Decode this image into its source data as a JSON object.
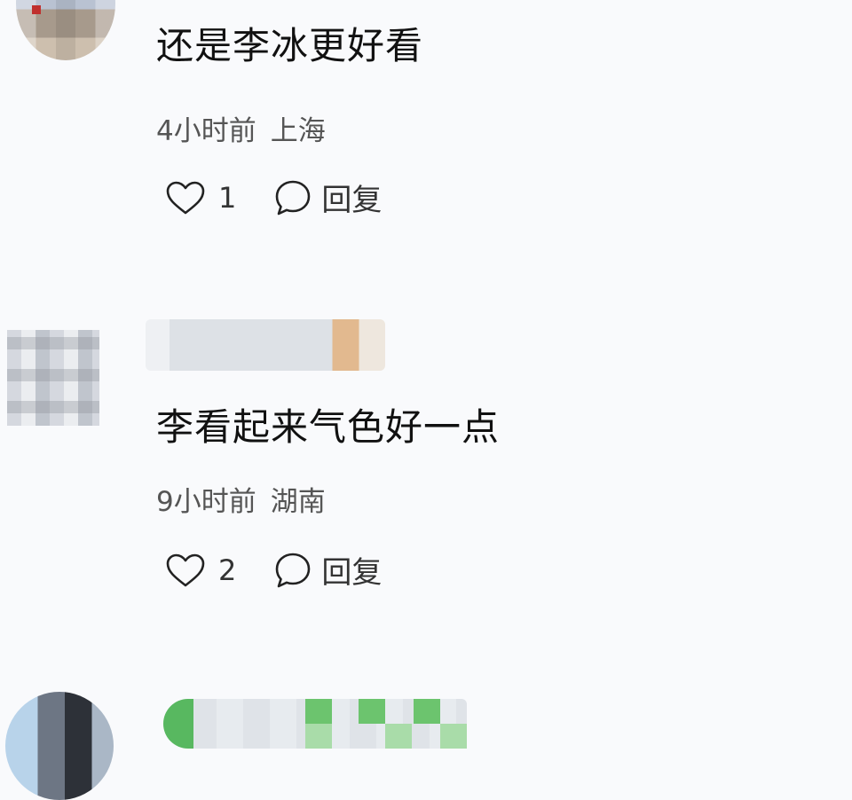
{
  "comments": [
    {
      "text": "还是李冰更好看",
      "time": "4小时前",
      "location": "上海",
      "likes": "1",
      "reply_label": "回复"
    },
    {
      "text": "李看起来气色好一点",
      "time": "9小时前",
      "location": "湖南",
      "likes": "2",
      "reply_label": "回复"
    }
  ],
  "icons": {
    "like": "heart-icon",
    "reply": "speech-bubble-icon"
  }
}
